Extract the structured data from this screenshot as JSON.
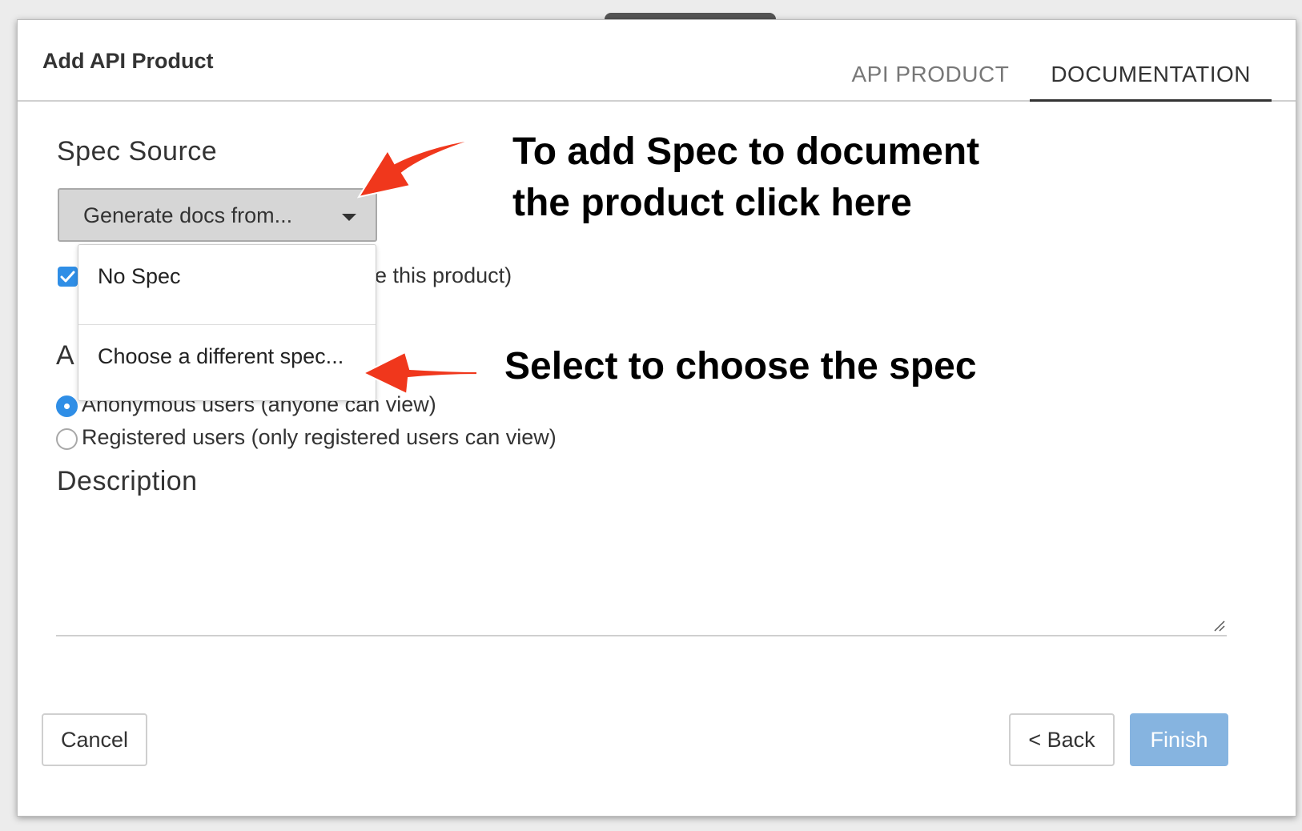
{
  "dialog": {
    "title": "Add API Product",
    "tabs": [
      {
        "label": "API PRODUCT",
        "active": false
      },
      {
        "label": "DOCUMENTATION",
        "active": true
      }
    ]
  },
  "spec_source": {
    "label": "Spec Source",
    "dropdown_value": "Generate docs from...",
    "menu_options": [
      "No Spec",
      "Choose a different spec..."
    ]
  },
  "checkbox": {
    "checked": true,
    "visible_text": "ee this product)"
  },
  "audience": {
    "label_partial": "A",
    "options": [
      {
        "label": "Anonymous users (anyone can view)",
        "selected": true
      },
      {
        "label": "Registered users (only registered users can view)",
        "selected": false
      }
    ]
  },
  "description": {
    "label": "Description",
    "value": ""
  },
  "buttons": {
    "cancel": "Cancel",
    "back": "< Back",
    "finish": "Finish"
  },
  "annotations": {
    "top_line1": "To add Spec to document",
    "top_line2": "the product click here",
    "middle": "Select to choose the spec",
    "arrow_color": "#f0371c"
  },
  "colors": {
    "accent": "#2f8ee6",
    "finish_button": "#86b4e0"
  }
}
